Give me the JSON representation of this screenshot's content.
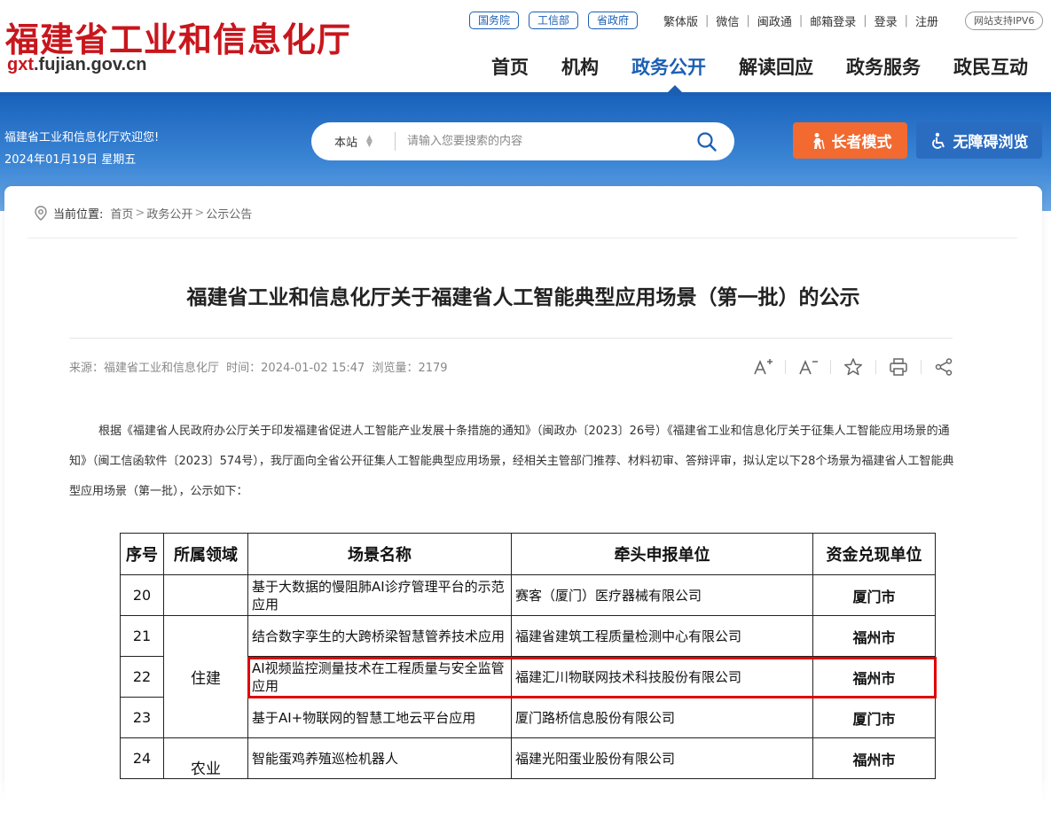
{
  "header": {
    "logo_cn": "福建省工业和信息化厅",
    "logo_en_prefix": "gxt",
    "logo_en_suffix": ".fujian.gov.cn",
    "pills": [
      "国务院",
      "工信部",
      "省政府"
    ],
    "top_links": [
      "繁体版",
      "微信",
      "闽政通",
      "邮箱登录",
      "登录",
      "注册"
    ],
    "ipv6": "网站支持IPV6",
    "nav": [
      "首页",
      "机构",
      "政务公开",
      "解读回应",
      "政务服务",
      "政民互动"
    ],
    "active_nav": "政务公开"
  },
  "banner": {
    "welcome": "福建省工业和信息化厅欢迎您!",
    "date": "2024年01月19日 星期五",
    "search_scope": "本站",
    "search_placeholder": "请输入您要搜索的内容",
    "elder_mode": "长者模式",
    "accessible": "无障碍浏览",
    "colors": {
      "elder": "#f26a2f",
      "accessible": "#2a6cc0",
      "brand": "#1b5fb4",
      "logo": "#c8161d"
    }
  },
  "breadcrumb": {
    "label": "当前位置:",
    "items": [
      "首页",
      "政务公开",
      "公示公告"
    ]
  },
  "article": {
    "title": "福建省工业和信息化厅关于福建省人工智能典型应用场景（第一批）的公示",
    "source": "来源：福建省工业和信息化厅",
    "time": "时间：2024-01-02 15:47",
    "views": "浏览量：2179",
    "tools": [
      "font-increase-icon",
      "font-decrease-icon",
      "star-icon",
      "print-icon",
      "share-icon"
    ],
    "paragraph": "根据《福建省人民政府办公厅关于印发福建省促进人工智能产业发展十条措施的通知》（闽政办〔2023〕26号）《福建省工业和信息化厅关于征集人工智能应用场景的通知》（闽工信函软件〔2023〕574号），我厅面向全省公开征集人工智能典型应用场景，经相关主管部门推荐、材料初审、答辩评审，拟认定以下28个场景为福建省人工智能典型应用场景（第一批），公示如下："
  },
  "table": {
    "headers": [
      "序号",
      "所属领域",
      "场景名称",
      "牵头申报单位",
      "资金兑现单位"
    ],
    "rows": [
      {
        "no": "20",
        "name": "基于大数据的慢阻肺AI诊疗管理平台的示范应用",
        "unit": "赛客（厦门）医疗器械有限公司",
        "city": "厦门市"
      },
      {
        "no": "21",
        "name": "结合数字孪生的大跨桥梁智慧管养技术应用",
        "unit": "福建省建筑工程质量检测中心有限公司",
        "city": "福州市"
      },
      {
        "no": "22",
        "name": "AI视频监控测量技术在工程质量与安全监管应用",
        "unit": "福建汇川物联网技术科技股份有限公司",
        "city": "福州市"
      },
      {
        "no": "23",
        "name": "基于AI+物联网的智慧工地云平台应用",
        "unit": "厦门路桥信息股份有限公司",
        "city": "厦门市"
      },
      {
        "no": "24",
        "name": "智能蛋鸡养殖巡检机器人",
        "unit": "福建光阳蛋业股份有限公司",
        "city": "福州市"
      }
    ],
    "field_construction": "住建",
    "field_agriculture": "农业"
  }
}
